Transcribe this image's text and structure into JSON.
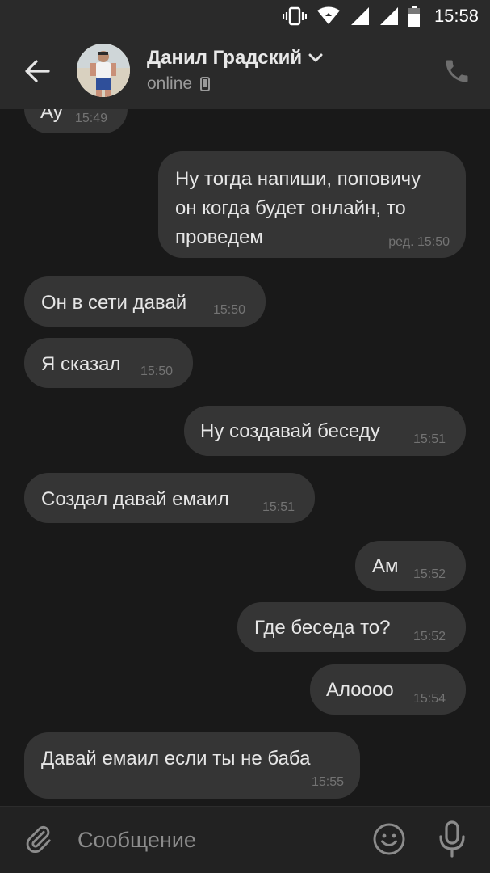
{
  "status_bar": {
    "time": "15:58"
  },
  "header": {
    "contact_name": "Данил Градский",
    "status": "online"
  },
  "messages": [
    {
      "text": "Ау",
      "time": "15:49",
      "outgoing": false
    },
    {
      "text": "Ну тогда напиши, поповичу\nон когда будет онлайн, то\nпроведем",
      "time": "ред. 15:50",
      "outgoing": true
    },
    {
      "text": "Он в сети давай",
      "time": "15:50",
      "outgoing": false
    },
    {
      "text": "Я сказал",
      "time": "15:50",
      "outgoing": false
    },
    {
      "text": "Ну создавай беседу",
      "time": "15:51",
      "outgoing": true
    },
    {
      "text": "Создал давай емаил",
      "time": "15:51",
      "outgoing": false
    },
    {
      "text": "Ам",
      "time": "15:52",
      "outgoing": true
    },
    {
      "text": "Где беседа то?",
      "time": "15:52",
      "outgoing": true
    },
    {
      "text": "Алоооо",
      "time": "15:54",
      "outgoing": true
    },
    {
      "text": "Давай емаил если ты не баба",
      "time": "15:55",
      "outgoing": false
    }
  ],
  "input": {
    "placeholder": "Сообщение",
    "value": ""
  },
  "colors": {
    "background": "#191919",
    "bar": "#2a2a2a",
    "bubble": "#353535",
    "timestamp": "#737373"
  }
}
